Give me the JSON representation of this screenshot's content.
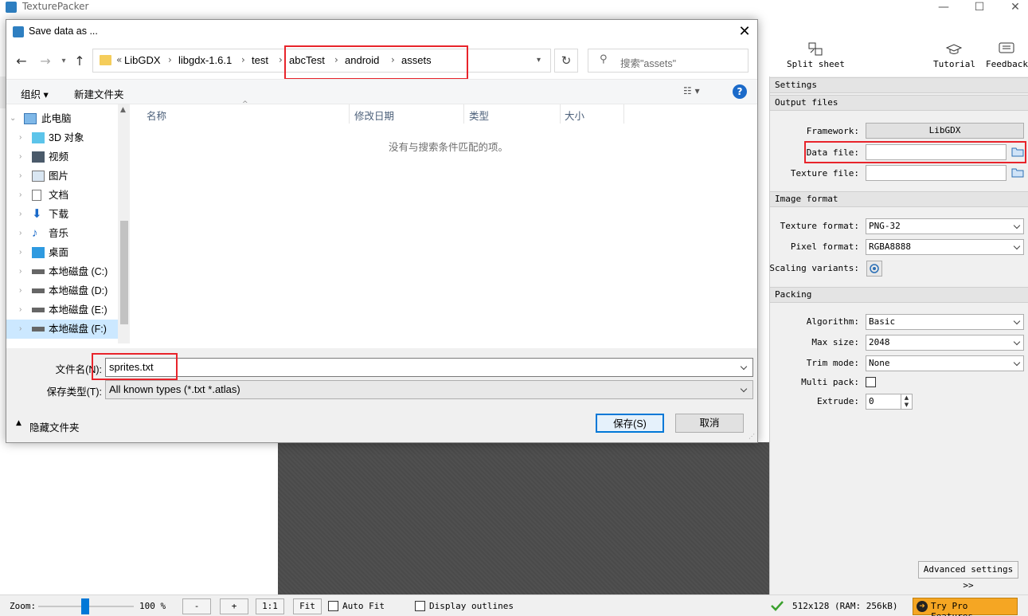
{
  "app": {
    "title": "TexturePacker",
    "window_controls": [
      "—",
      "☐",
      "✕"
    ]
  },
  "toolbar": {
    "split_sheet": "Split sheet",
    "tutorial": "Tutorial",
    "feedback": "Feedback"
  },
  "settings": {
    "section_settings": "Settings",
    "section_output": "Output files",
    "framework_label": "Framework:",
    "framework_value": "LibGDX",
    "data_file_label": "Data file:",
    "data_file_value": "",
    "texture_file_label": "Texture file:",
    "texture_file_value": "",
    "section_image": "Image format",
    "texture_format_label": "Texture format:",
    "texture_format_value": "PNG-32",
    "pixel_format_label": "Pixel format:",
    "pixel_format_value": "RGBA8888",
    "scaling_label": "Scaling variants:",
    "section_packing": "Packing",
    "algorithm_label": "Algorithm:",
    "algorithm_value": "Basic",
    "max_size_label": "Max size:",
    "max_size_value": "2048",
    "trim_mode_label": "Trim mode:",
    "trim_mode_value": "None",
    "multi_pack_label": "Multi pack:",
    "multi_pack_checked": false,
    "extrude_label": "Extrude:",
    "extrude_value": "0",
    "advanced_button": "Advanced settings >>"
  },
  "statusbar": {
    "zoom_label": "Zoom:",
    "zoom_value": "100 %",
    "zoom_level": 0.45,
    "minus": "-",
    "plus": "+",
    "one_to_one": "1:1",
    "fit": "Fit",
    "auto_fit": "Auto Fit",
    "display_outlines": "Display outlines",
    "status": "512x128 (RAM: 256kB)",
    "pro_button": "Try Pro Features."
  },
  "dialog": {
    "title": "Save data as ...",
    "breadcrumb": [
      "LibGDX",
      "libgdx-1.6.1",
      "test",
      "abcTest",
      "android",
      "assets"
    ],
    "overflow": "«",
    "search_placeholder": "搜索\"assets\"",
    "organize": "组织 ▾",
    "new_folder": "新建文件夹",
    "tree": [
      {
        "label": "此电脑",
        "icon": "computer-icon"
      },
      {
        "label": "3D 对象",
        "icon": "3d-objects-icon"
      },
      {
        "label": "视频",
        "icon": "video-icon"
      },
      {
        "label": "图片",
        "icon": "pictures-icon"
      },
      {
        "label": "文档",
        "icon": "documents-icon"
      },
      {
        "label": "下载",
        "icon": "download-icon"
      },
      {
        "label": "音乐",
        "icon": "music-icon"
      },
      {
        "label": "桌面",
        "icon": "desktop-icon"
      },
      {
        "label": "本地磁盘 (C:)",
        "icon": "drive-icon"
      },
      {
        "label": "本地磁盘 (D:)",
        "icon": "drive-icon"
      },
      {
        "label": "本地磁盘 (E:)",
        "icon": "drive-icon"
      },
      {
        "label": "本地磁盘 (F:)",
        "icon": "drive-icon"
      }
    ],
    "columns": [
      "名称",
      "修改日期",
      "类型",
      "大小"
    ],
    "empty_message": "没有与搜索条件匹配的项。",
    "filename_label": "文件名(N):",
    "filename_value": "sprites.txt",
    "filetype_label": "保存类型(T):",
    "filetype_value": "All known types (*.txt *.atlas)",
    "hide_folders": "隐藏文件夹",
    "save_button": "保存(S)",
    "cancel_button": "取消"
  },
  "colors": {
    "highlight": "#e8242b",
    "accent": "#0078d7",
    "pro": "#f5a623"
  }
}
